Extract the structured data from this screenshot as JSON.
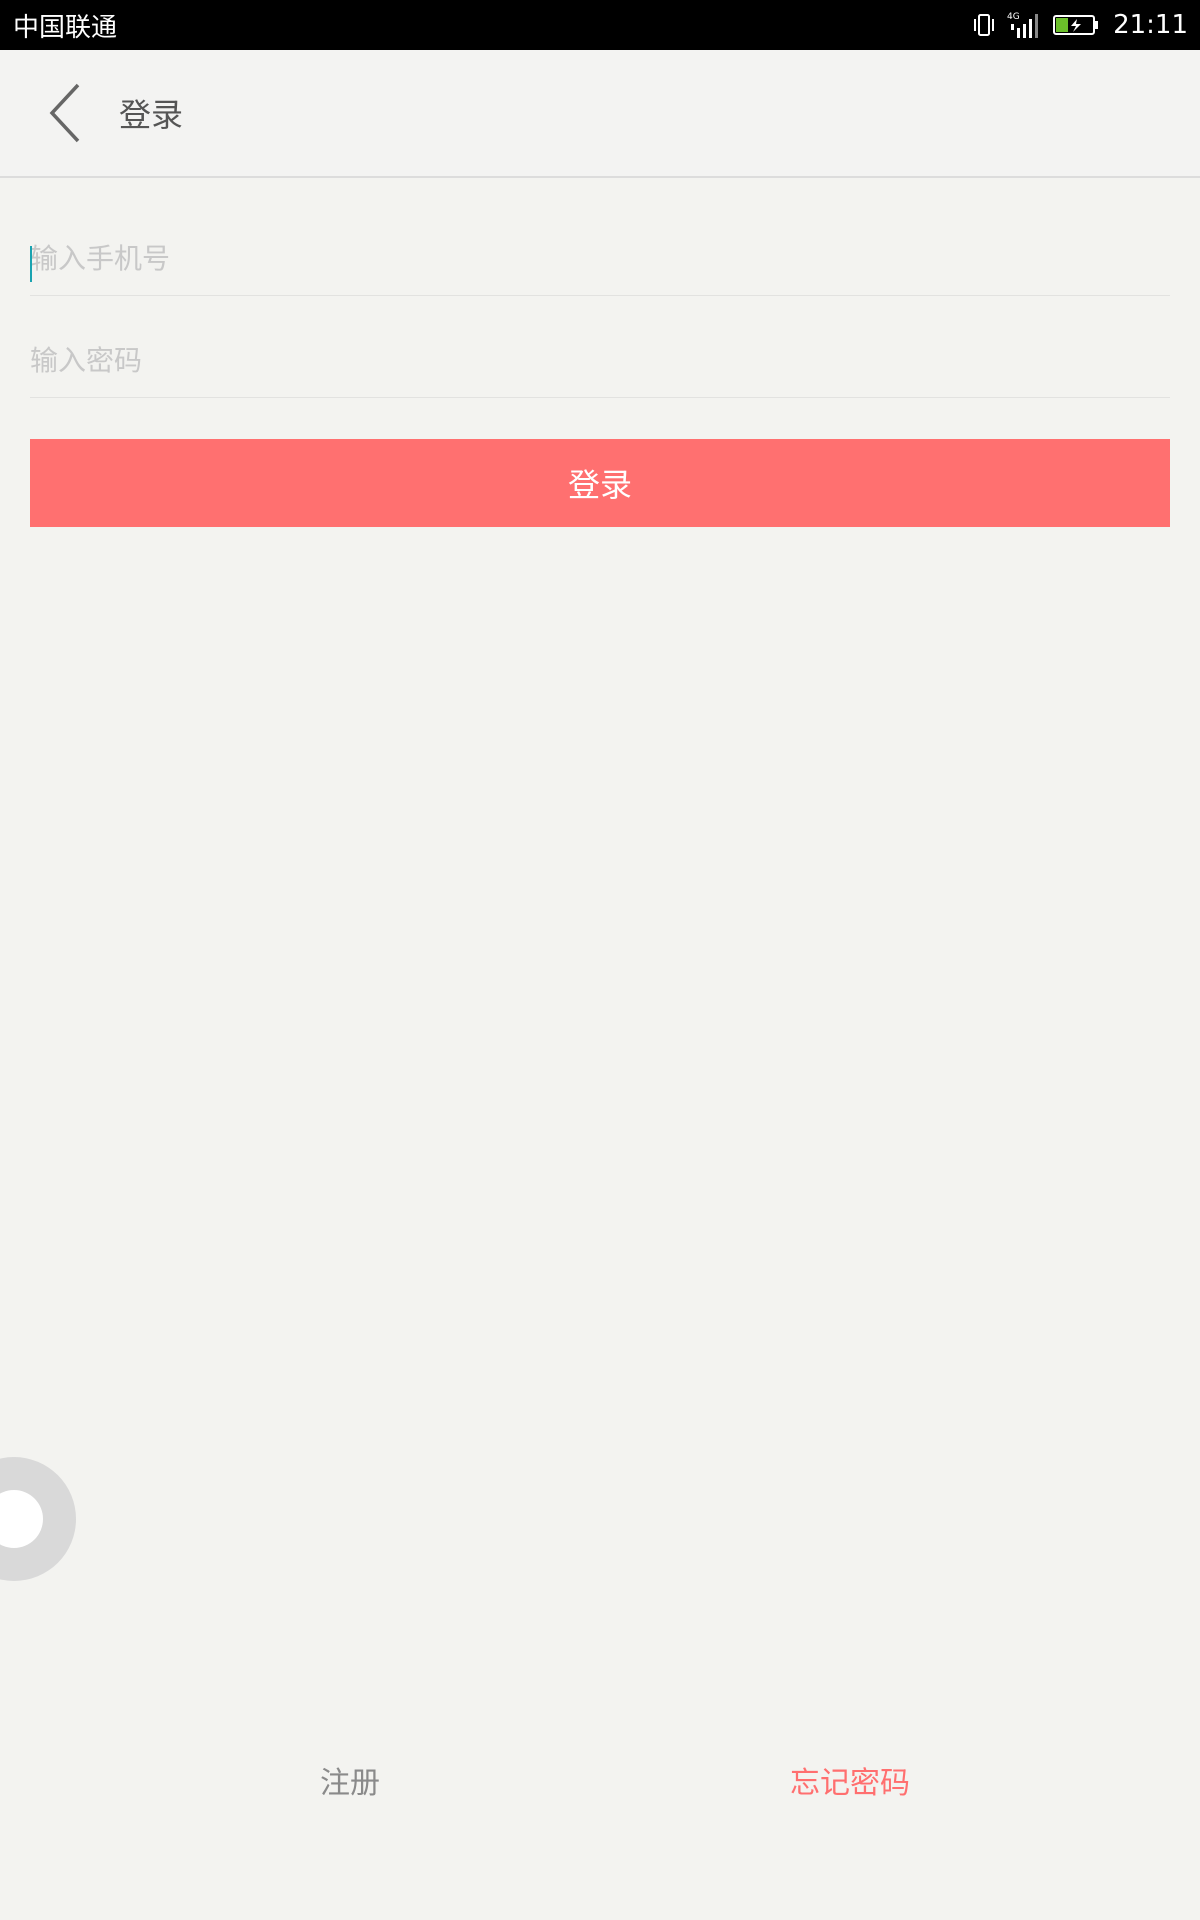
{
  "status_bar": {
    "carrier": "中国联通",
    "network": "4G",
    "time": "21:11"
  },
  "header": {
    "title": "登录",
    "back_icon": "chevron-left-icon"
  },
  "form": {
    "phone_placeholder": "输入手机号",
    "phone_value": "",
    "password_placeholder": "输入密码",
    "password_value": "",
    "submit_label": "登录"
  },
  "footer": {
    "register_label": "注册",
    "forgot_label": "忘记密码"
  },
  "colors": {
    "accent": "#ff7070",
    "background": "#f3f3f0",
    "caret": "#1aa3b0"
  }
}
